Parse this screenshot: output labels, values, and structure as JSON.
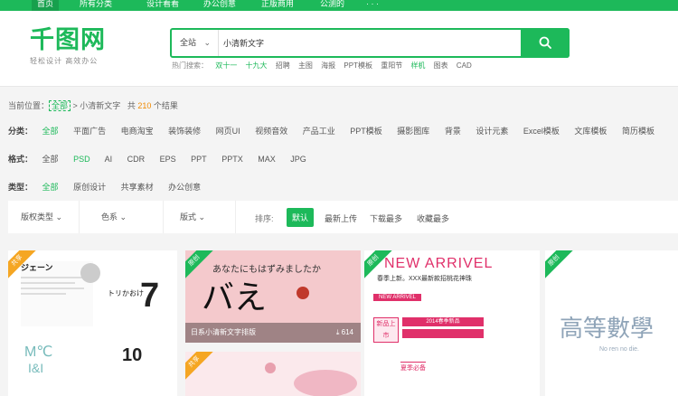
{
  "topnav": {
    "items": [
      "首页",
      "所有分类",
      "设计看看",
      "办公创意",
      "正版商用",
      "公测的",
      "· · ·"
    ]
  },
  "logo": {
    "text": "千图网",
    "slogan": "轻松设计 高效办公"
  },
  "search": {
    "scope": "全站",
    "value": "小清新文字"
  },
  "hot": {
    "label": "热门搜索：",
    "tags": [
      {
        "t": "双十一",
        "green": true
      },
      {
        "t": "十九大",
        "green": true
      },
      {
        "t": "招聘",
        "green": false
      },
      {
        "t": "主图",
        "green": false
      },
      {
        "t": "海报",
        "green": false
      },
      {
        "t": "PPT模板",
        "green": false
      },
      {
        "t": "重阳节",
        "green": false
      },
      {
        "t": "样机",
        "green": true
      },
      {
        "t": "图表",
        "green": false
      },
      {
        "t": "CAD",
        "green": false
      }
    ]
  },
  "breadcrumb": {
    "prefix": "当前位置：",
    "all": "全部",
    "sep": " > ",
    "query": "小清新文字",
    "total_pre": "共",
    "total": "210",
    "total_post": "个结果"
  },
  "filters": {
    "category": {
      "label": "分类：",
      "options": [
        "全部",
        "平面广告",
        "电商淘宝",
        "装饰装修",
        "网页UI",
        "视频音效",
        "产品工业",
        "PPT模板",
        "摄影图库",
        "背景",
        "设计元素",
        "Excel模板",
        "文库模板",
        "简历模板"
      ]
    },
    "format": {
      "label": "格式：",
      "options": [
        "全部",
        "PSD",
        "AI",
        "CDR",
        "EPS",
        "PPT",
        "PPTX",
        "MAX",
        "JPG"
      ]
    },
    "type": {
      "label": "类型：",
      "options": [
        "全部",
        "原创设计",
        "共享素材",
        "办公创意"
      ]
    }
  },
  "sortbar": {
    "dropdowns": [
      "版权类型",
      "色系",
      "版式"
    ],
    "label": "排序:",
    "options": [
      "默认",
      "最新上传",
      "下载最多",
      "收藏最多"
    ]
  },
  "cards": [
    {
      "badge": "共享",
      "badge_color": "orange"
    },
    {
      "badge": "原创",
      "badge_color": "green",
      "jp_title": "あなたにもはずみましたか",
      "big_text": "バえ",
      "caption": "日系小清新文字排版",
      "downloads": "614"
    },
    {
      "badge": "原创",
      "badge_color": "green",
      "title": "NEW ARRIVEL",
      "sub": "春季上新。XXX最新款招桃花神珠",
      "tag1": "NEW ARRIVEL",
      "tag2": "新品上市",
      "tag3": "2014春季新品",
      "tag4": "夏季必备"
    },
    {
      "badge": "原创",
      "badge_color": "green",
      "big_text": "高等數學",
      "sub": "No ren no die."
    }
  ],
  "card_extra": {
    "p1_texts": [
      "ジェーン",
      "トリかおけ",
      "7",
      "10",
      "M℃",
      "I&I"
    ],
    "p2_badge": "共享"
  }
}
